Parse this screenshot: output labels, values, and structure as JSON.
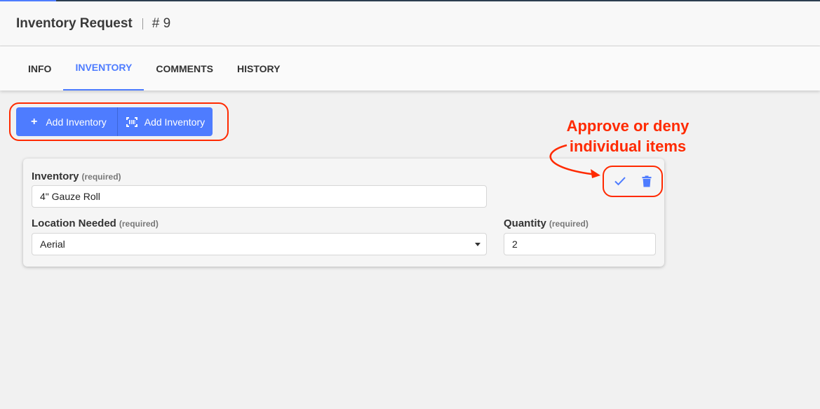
{
  "header": {
    "title": "Inventory Request",
    "number": "# 9"
  },
  "tabs": [
    {
      "label": "INFO",
      "active": false
    },
    {
      "label": "INVENTORY",
      "active": true
    },
    {
      "label": "COMMENTS",
      "active": false
    },
    {
      "label": "HISTORY",
      "active": false
    }
  ],
  "toolbar": {
    "add_label": "Add Inventory",
    "scan_add_label": "Add Inventory",
    "add_icon": "plus-icon",
    "scan_icon": "barcode-scan-icon"
  },
  "item": {
    "inventory_label": "Inventory",
    "inventory_required": "(required)",
    "inventory_value": "4\" Gauze Roll",
    "location_label": "Location Needed",
    "location_required": "(required)",
    "location_value": "Aerial",
    "quantity_label": "Quantity",
    "quantity_required": "(required)",
    "quantity_value": "2",
    "approve_icon": "check-icon",
    "deny_icon": "trash-icon"
  },
  "annotation": {
    "line1": "Approve or deny",
    "line2": "individual items"
  },
  "colors": {
    "accent": "#4e7cff",
    "annotation": "#ff2a00",
    "background": "#f1f1f1"
  }
}
